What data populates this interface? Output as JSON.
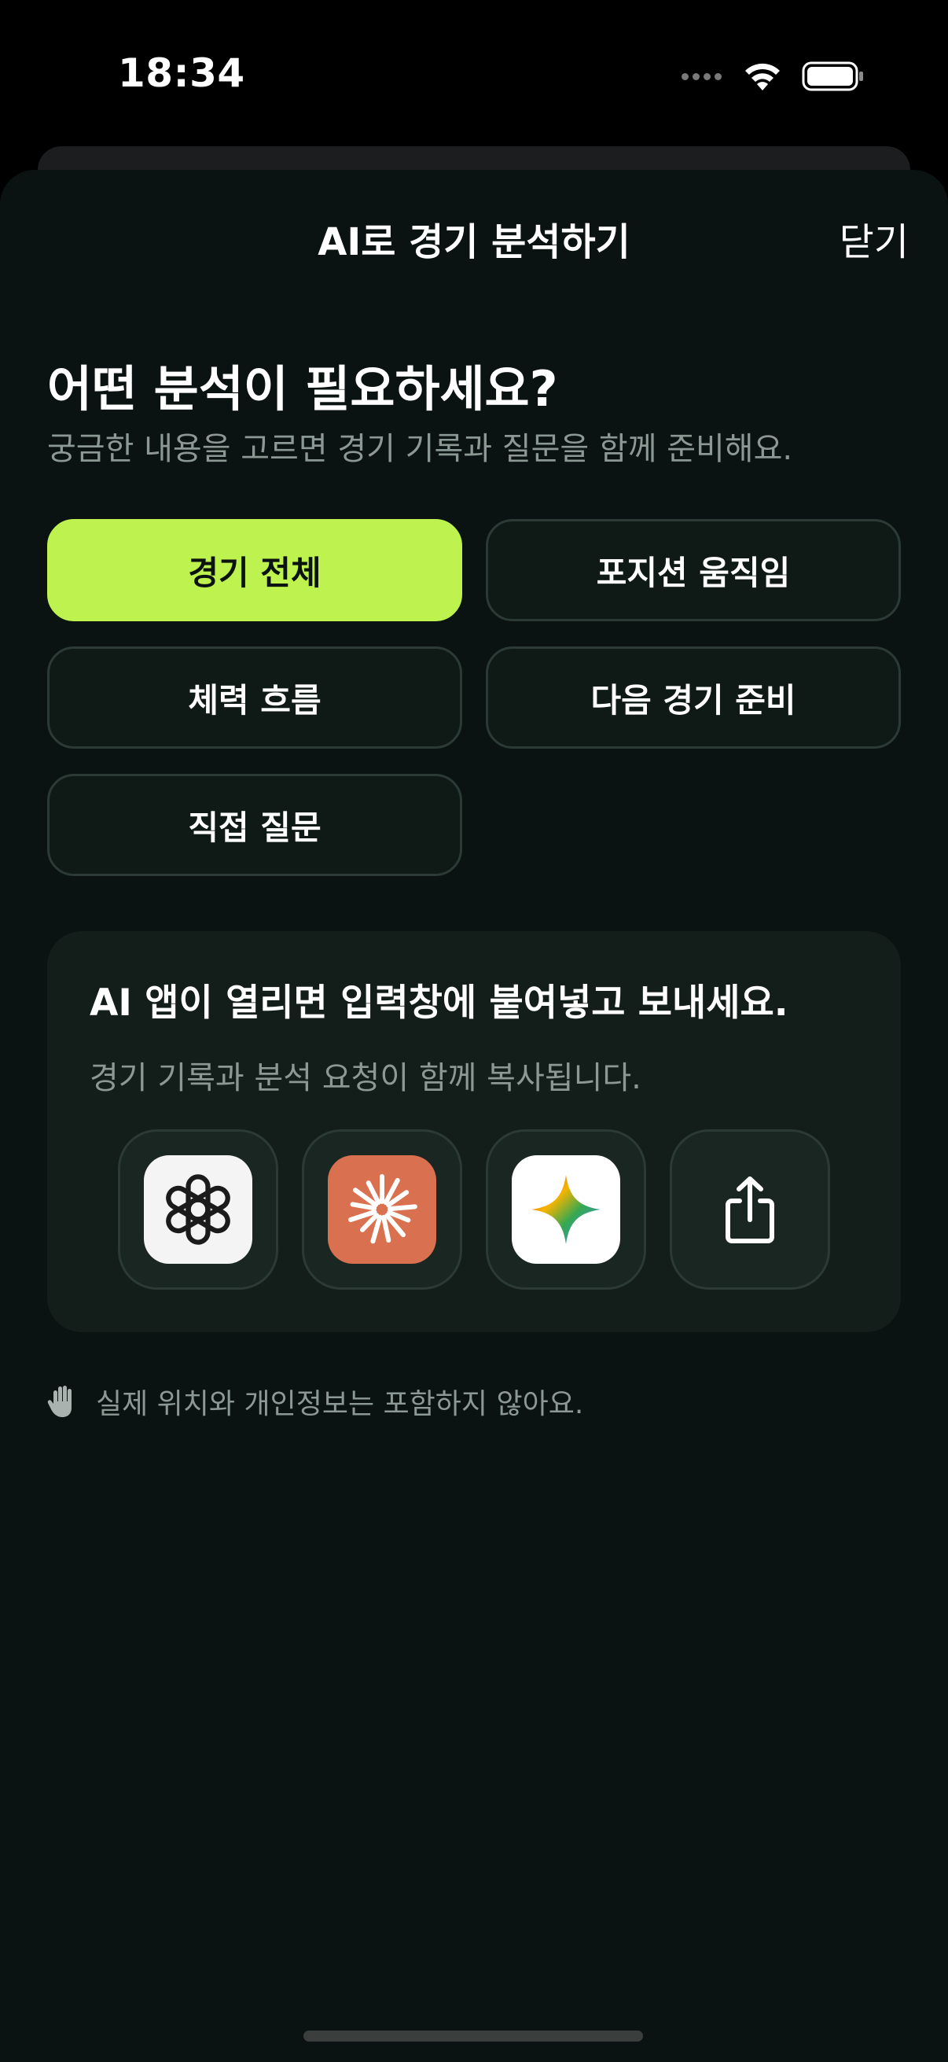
{
  "status_bar": {
    "time": "18:34"
  },
  "sheet": {
    "title": "AI로 경기 분석하기",
    "close_label": "닫기"
  },
  "question": {
    "headline": "어떤 분석이 필요하세요?",
    "subline": "궁금한 내용을 고르면 경기 기록과 질문을 함께 준비해요."
  },
  "options": [
    {
      "label": "경기 전체",
      "selected": true
    },
    {
      "label": "포지션 움직임",
      "selected": false
    },
    {
      "label": "체력 흐름",
      "selected": false
    },
    {
      "label": "다음 경기 준비",
      "selected": false
    },
    {
      "label": "직접 질문",
      "selected": false
    }
  ],
  "share_card": {
    "title": "AI 앱이 열리면 입력창에 붙여넣고 보내세요.",
    "subtitle": "경기 기록과 분석 요청이 함께 복사됩니다.",
    "apps": [
      {
        "icon": "chatgpt-icon"
      },
      {
        "icon": "claude-icon"
      },
      {
        "icon": "gemini-icon"
      },
      {
        "icon": "share-icon"
      }
    ]
  },
  "privacy_note": "실제 위치와 개인정보는 포함하지 않아요.",
  "colors": {
    "accent": "#bdf24f",
    "sheet_background": "#0a1311",
    "card_background": "#131d1a",
    "muted_text": "#8c9893"
  }
}
